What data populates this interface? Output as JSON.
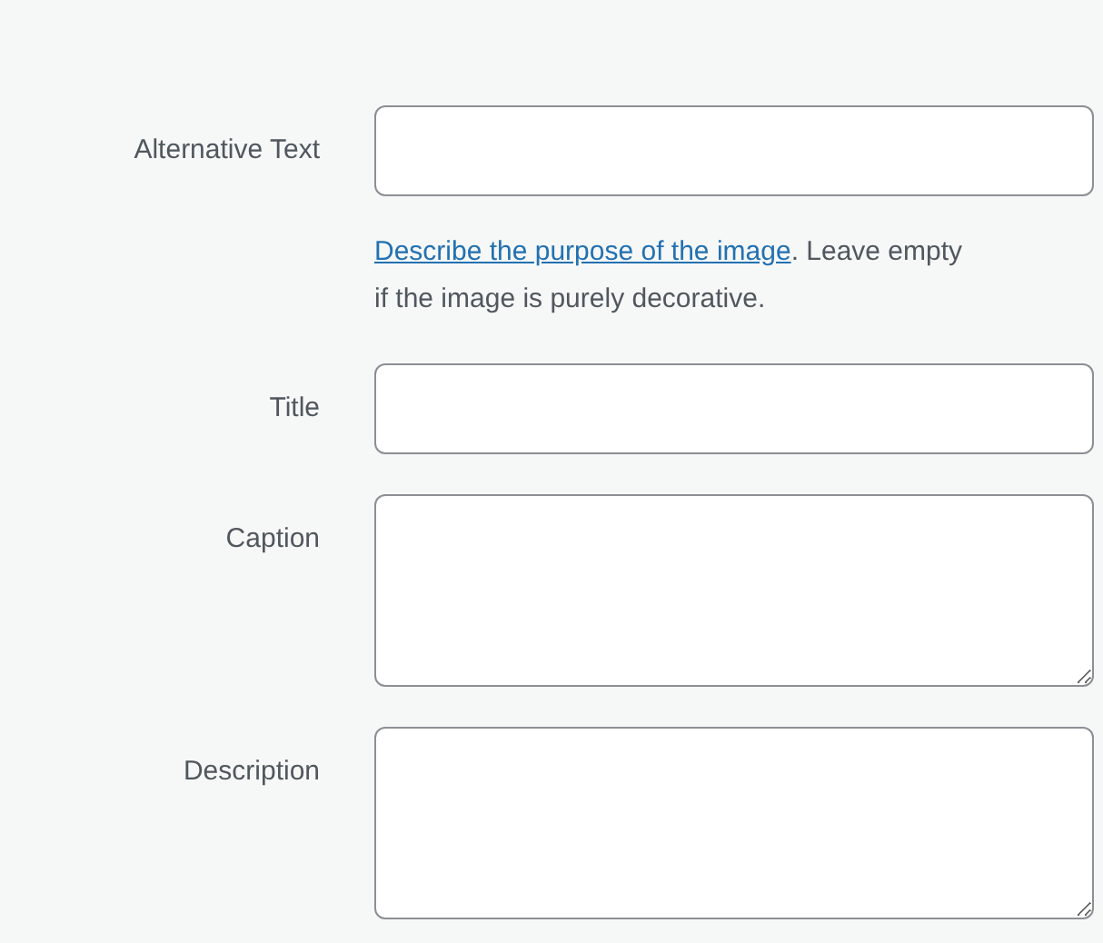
{
  "fields": [
    {
      "label": "Alternative Text",
      "kind": "input",
      "help_link": "Describe the purpose of the image",
      "help_text": ". Leave empty if the image is purely decorative."
    },
    {
      "label": "Title",
      "kind": "input"
    },
    {
      "label": "Caption",
      "kind": "textarea"
    },
    {
      "label": "Description",
      "kind": "textarea"
    }
  ]
}
